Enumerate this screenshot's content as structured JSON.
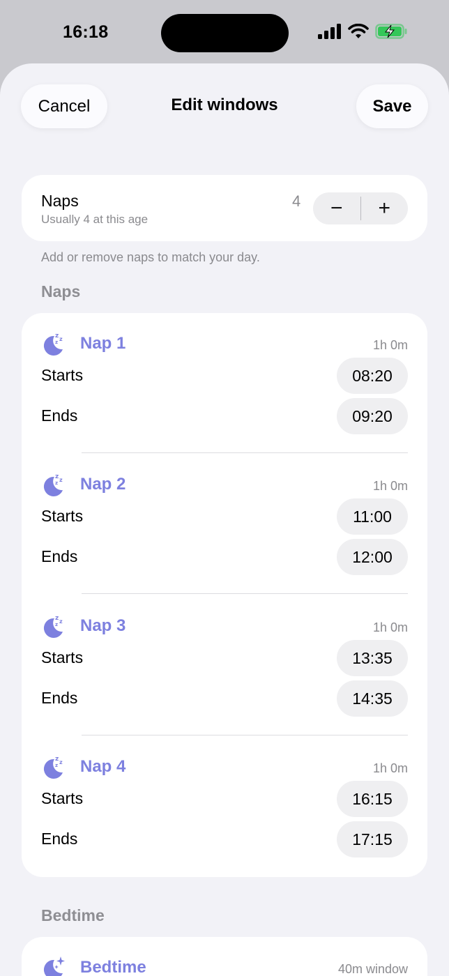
{
  "status_bar": {
    "time": "16:18"
  },
  "header": {
    "cancel_label": "Cancel",
    "title": "Edit windows",
    "save_label": "Save"
  },
  "nap_count": {
    "title": "Naps",
    "subtitle": "Usually 4 at this age",
    "value": "4",
    "decrement_label": "−",
    "increment_label": "+",
    "hint": "Add or remove naps to match your day."
  },
  "naps_section": {
    "label": "Naps",
    "items": [
      {
        "title": "Nap 1",
        "duration": "1h 0m",
        "starts_label": "Starts",
        "start": "08:20",
        "ends_label": "Ends",
        "end": "09:20"
      },
      {
        "title": "Nap 2",
        "duration": "1h 0m",
        "starts_label": "Starts",
        "start": "11:00",
        "ends_label": "Ends",
        "end": "12:00"
      },
      {
        "title": "Nap 3",
        "duration": "1h 0m",
        "starts_label": "Starts",
        "start": "13:35",
        "ends_label": "Ends",
        "end": "14:35"
      },
      {
        "title": "Nap 4",
        "duration": "1h 0m",
        "starts_label": "Starts",
        "start": "16:15",
        "ends_label": "Ends",
        "end": "17:15"
      }
    ]
  },
  "bedtime_section": {
    "label": "Bedtime",
    "title": "Bedtime",
    "window": "40m window"
  },
  "colors": {
    "accent": "#7d80df",
    "battery": "#34c759",
    "sheet_bg": "#f2f2f7"
  },
  "icons": {
    "nap": "moon-zzz-icon",
    "bedtime": "moon-stars-icon"
  }
}
